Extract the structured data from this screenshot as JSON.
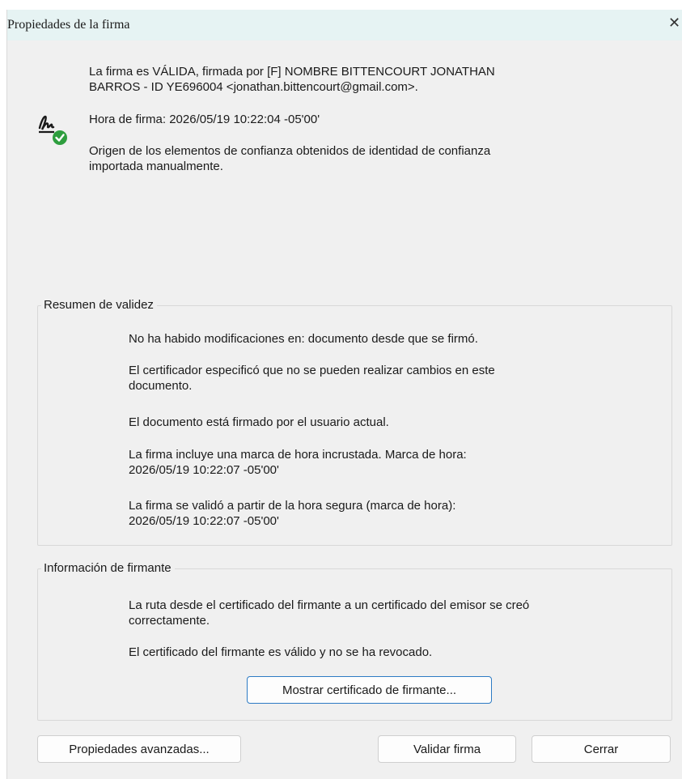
{
  "dialog": {
    "title": "Propiedades de la firma",
    "close_glyph": "✕"
  },
  "header": {
    "status_text": "La firma es VÁLIDA, firmada por [F] NOMBRE BITTENCOURT JONATHAN\nBARROS - ID YE696004 <jonathan.bittencourt@gmail.com>.",
    "signing_time": "Hora de firma:  2026/05/19 10:22:04 -05'00'",
    "trust_source": "Origen de los elementos de confianza obtenidos de identidad de confianza\nimportada manualmente.",
    "icon": "signature-valid-icon",
    "valid_color": "#2e9e3e"
  },
  "validity": {
    "legend": "Resumen de validez",
    "items": [
      "No ha habido modificaciones en: documento desde que se firmó.",
      "El certificador especificó que no se pueden realizar cambios en este\ndocumento.",
      "El documento está firmado por el usuario actual.",
      "La firma incluye una marca de hora incrustada. Marca de hora:\n2026/05/19 10:22:07 -05'00'",
      "La firma se validó a partir de la hora segura (marca de hora):\n2026/05/19 10:22:07 -05'00'"
    ]
  },
  "signer": {
    "legend": "Información de firmante",
    "items": [
      "La ruta desde el certificado del firmante a un certificado del emisor se creó\ncorrectamente.",
      "El certificado del firmante es válido y no se ha revocado."
    ],
    "show_cert_label": "Mostrar certificado de firmante..."
  },
  "footer": {
    "advanced_label": "Propiedades avanzadas...",
    "validate_label": "Validar firma",
    "close_label": "Cerrar"
  }
}
